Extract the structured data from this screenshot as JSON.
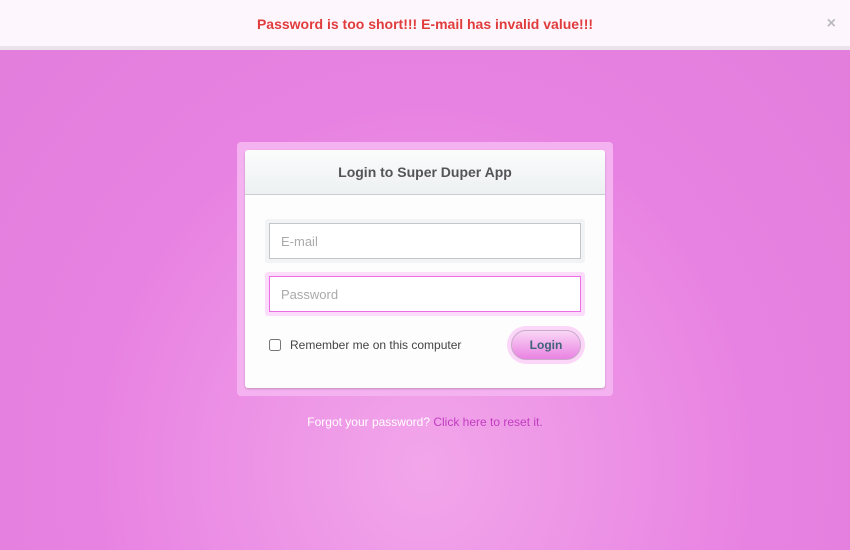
{
  "alert": {
    "message": "Password is too short!!! E-mail has invalid value!!!",
    "close": "×"
  },
  "login": {
    "title": "Login to Super Duper App",
    "email_placeholder": "E-mail",
    "password_placeholder": "Password",
    "remember_label": "Remember me on this computer",
    "login_button": "Login"
  },
  "forgot": {
    "text": "Forgot your password?",
    "link": "Click here to reset it."
  }
}
